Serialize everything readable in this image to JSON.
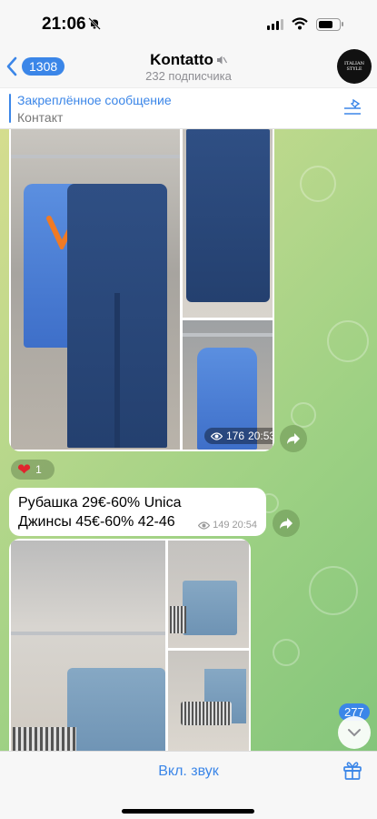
{
  "status_bar": {
    "time": "21:06"
  },
  "header": {
    "back_count": "1308",
    "title": "Kontatto",
    "subscribers": "232 подписчика",
    "avatar_text": "ITALIAN STYLE"
  },
  "pinned": {
    "title": "Закреплённое сообщение",
    "text": "Контакт"
  },
  "messages": [
    {
      "type": "album",
      "views": "176",
      "time": "20:53",
      "reaction_emoji": "❤",
      "reaction_count": "1"
    },
    {
      "type": "text",
      "lines": [
        "Рубашка 29€-60% Unica",
        "Джинсы 45€-60% 42-46"
      ],
      "views": "149",
      "time": "20:54"
    },
    {
      "type": "album"
    }
  ],
  "unread_count": "277",
  "bottom": {
    "unmute_label": "Вкл. звук"
  },
  "colors": {
    "accent": "#3b86e8"
  }
}
